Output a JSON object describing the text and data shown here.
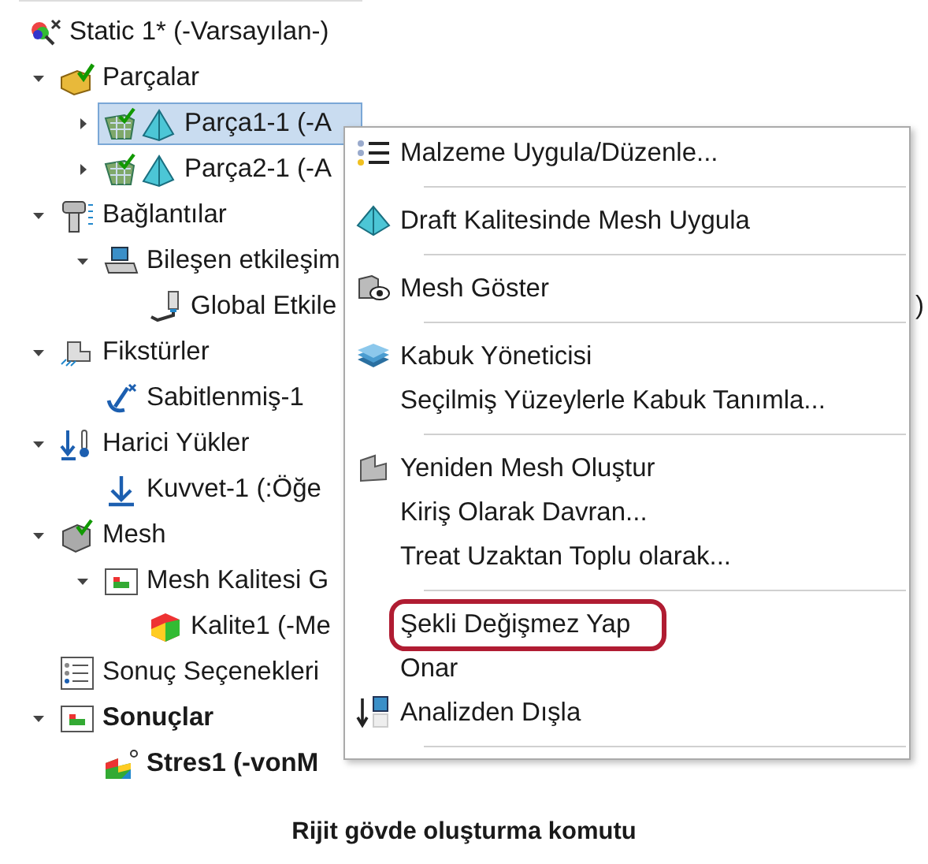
{
  "tree": {
    "label": "Static 1* (-Varsayılan-)",
    "children": [
      {
        "label": "Parçalar",
        "expanded": true,
        "bold": false,
        "children": [
          {
            "label": "Parça1-1 (-A",
            "expanded": false,
            "selected": true,
            "bold": false
          },
          {
            "label": "Parça2-1 (-A",
            "expanded": false,
            "selected": false,
            "bold": false
          }
        ]
      },
      {
        "label": "Bağlantılar",
        "expanded": true,
        "bold": false,
        "children": [
          {
            "label": "Bileşen etkileşim",
            "expanded": true,
            "bold": false,
            "children": [
              {
                "label": "Global Etkile",
                "tail": ")",
                "bold": false
              }
            ]
          }
        ]
      },
      {
        "label": "Fikstürler",
        "expanded": true,
        "bold": false,
        "children": [
          {
            "label": "Sabitlenmiş-1",
            "bold": false
          }
        ]
      },
      {
        "label": "Harici Yükler",
        "expanded": true,
        "bold": false,
        "children": [
          {
            "label": "Kuvvet-1 (:Öğe",
            "bold": false
          }
        ]
      },
      {
        "label": "Mesh",
        "expanded": true,
        "bold": false,
        "children": [
          {
            "label": "Mesh Kalitesi G",
            "expanded": true,
            "bold": false,
            "children": [
              {
                "label": "Kalite1 (-Me",
                "bold": false
              }
            ]
          }
        ]
      },
      {
        "label": "Sonuç Seçenekleri",
        "bold": false
      },
      {
        "label": "Sonuçlar",
        "expanded": true,
        "bold": true,
        "children": [
          {
            "label": "Stres1 (-vonM",
            "bold": true
          }
        ]
      }
    ]
  },
  "context_menu": {
    "groups": [
      [
        {
          "label": "Malzeme Uygula/Düzenle...",
          "callout": false
        }
      ],
      [
        {
          "label": "Draft Kalitesinde Mesh Uygula",
          "callout": false
        }
      ],
      [
        {
          "label": "Mesh Göster",
          "callout": false
        }
      ],
      [
        {
          "label": "Kabuk Yöneticisi",
          "callout": false
        },
        {
          "label": "Seçilmiş Yüzeylerle Kabuk Tanımla...",
          "callout": false
        }
      ],
      [
        {
          "label": "Yeniden Mesh Oluştur",
          "callout": false
        },
        {
          "label": "Kiriş Olarak Davran...",
          "callout": false
        },
        {
          "label": "Treat Uzaktan Toplu olarak...",
          "callout": false
        }
      ],
      [
        {
          "label": "Şekli Değişmez Yap",
          "callout": true
        },
        {
          "label": "Onar",
          "callout": false
        },
        {
          "label": "Analizden Dışla",
          "callout": false
        }
      ]
    ]
  },
  "caption": "Rijit gövde oluşturma komutu"
}
